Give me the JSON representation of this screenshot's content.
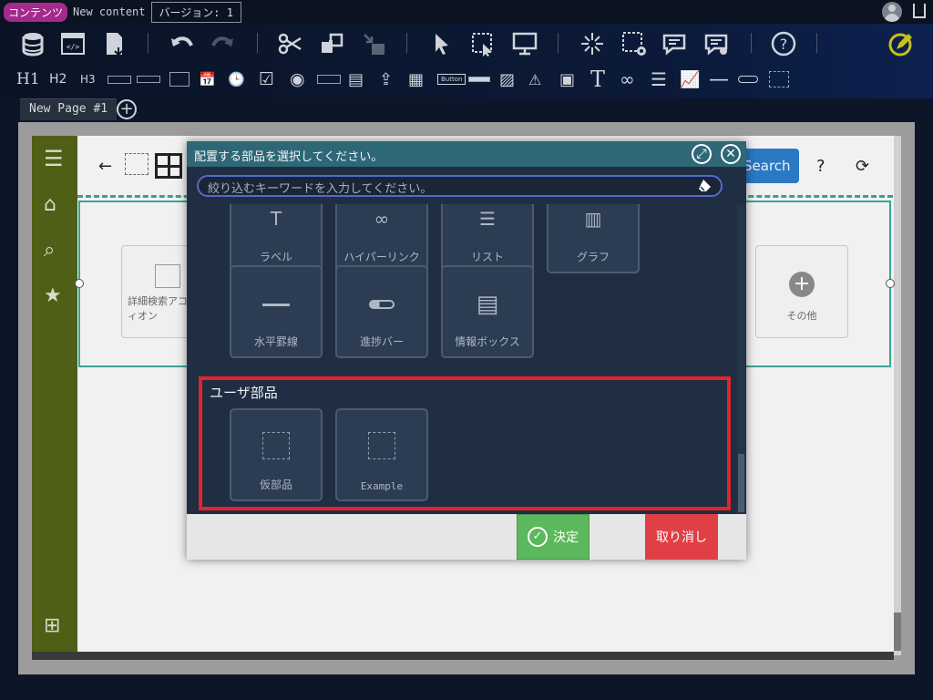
{
  "topbar": {
    "badge": "コンテンツ",
    "content_name": "New content",
    "version": "バージョン: 1"
  },
  "toolbar": {
    "headings": [
      "H1",
      "H2",
      "H3"
    ]
  },
  "tabs": {
    "page_tab": "New Page #1"
  },
  "page": {
    "search_button": "Search",
    "help": "?",
    "card_left": "詳細検索アコーディオン",
    "card_right": "その他"
  },
  "dialog": {
    "title": "配置する部品を選択してください。",
    "search_placeholder": "絞り込むキーワードを入力してください。",
    "row1": [
      "ラベル",
      "ハイパーリンク",
      "リスト",
      "グラフ"
    ],
    "row2": [
      "水平罫線",
      "進捗バー",
      "情報ボックス"
    ],
    "user_section_title": "ユーザ部品",
    "user_parts": [
      "仮部品",
      "Example"
    ],
    "ok_label": "決定",
    "cancel_label": "取り消し"
  },
  "icons": {
    "toolbar_row1": [
      "database-icon",
      "html-icon",
      "document-download-icon",
      "undo-icon",
      "redo-icon",
      "cut-icon",
      "copy-icon",
      "paste-icon",
      "pointer-icon",
      "select-region-icon",
      "monitor-icon",
      "sparkle-icon",
      "region-settings-icon",
      "comment-edit-icon",
      "comment-settings-icon",
      "help-icon",
      "pencil-icon"
    ]
  },
  "colors": {
    "accent_green": "#5cb85c",
    "accent_red": "#e04045",
    "highlight": "#e3222e",
    "dialog_header": "#2e6776"
  }
}
